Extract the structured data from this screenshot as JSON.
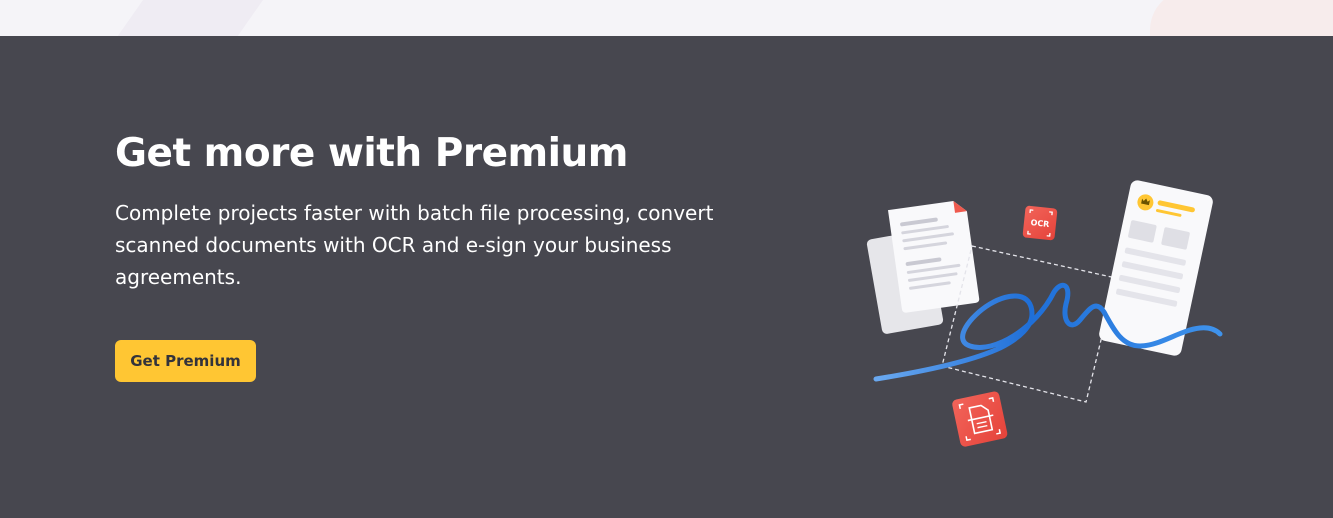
{
  "promo": {
    "title": "Get more with Premium",
    "description": "Complete projects faster with batch file processing, convert scanned documents with OCR and e-sign your business agreements.",
    "cta_label": "Get Premium"
  },
  "illustration": {
    "ocr_badge_label": "OCR"
  },
  "colors": {
    "banner_background": "#47474f",
    "top_background": "#f5f4f8",
    "accent_yellow": "#ffc633",
    "badge_red": "#ef5040",
    "signature_blue": "#2d7be0",
    "text_white": "#ffffff"
  }
}
